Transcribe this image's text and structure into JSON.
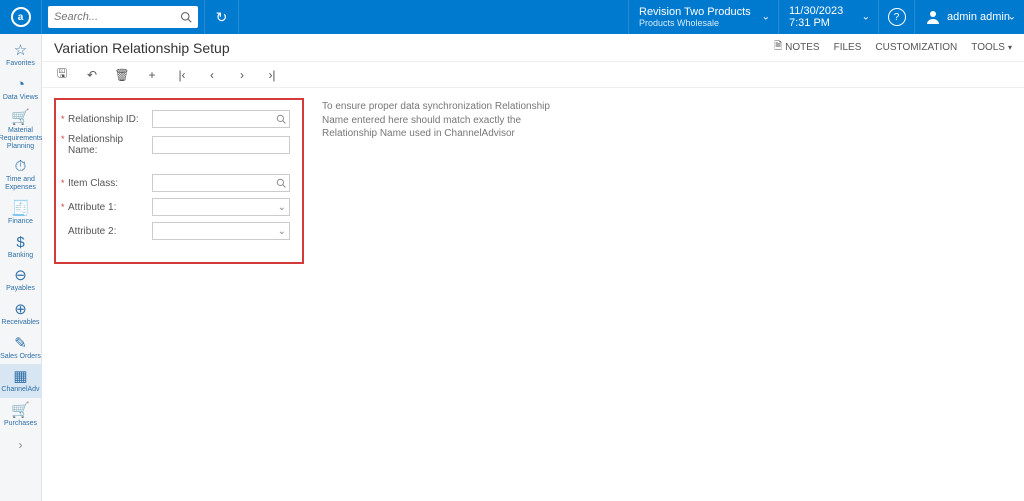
{
  "top": {
    "search_placeholder": "Search...",
    "tenant_line1": "Revision Two Products",
    "tenant_line2": "Products Wholesale",
    "date": "11/30/2023",
    "time": "7:31 PM",
    "user": "admin admin"
  },
  "nav": {
    "items": [
      {
        "label": "Favorites",
        "icon": "☆"
      },
      {
        "label": "Data Views",
        "icon": "◔"
      },
      {
        "label": "Material Requirements Planning",
        "icon": "🛒"
      },
      {
        "label": "Time and Expenses",
        "icon": "⏱"
      },
      {
        "label": "Finance",
        "icon": "🧾"
      },
      {
        "label": "Banking",
        "icon": "$"
      },
      {
        "label": "Payables",
        "icon": "⊖"
      },
      {
        "label": "Receivables",
        "icon": "⊕"
      },
      {
        "label": "Sales Orders",
        "icon": "✎"
      },
      {
        "label": "ChannelAdv",
        "icon": "▦"
      },
      {
        "label": "Purchases",
        "icon": "🛒"
      }
    ],
    "active_index": 9
  },
  "page": {
    "title": "Variation Relationship Setup",
    "actions": {
      "notes": "NOTES",
      "files": "FILES",
      "customization": "CUSTOMIZATION",
      "tools": "TOOLS"
    }
  },
  "form": {
    "relationship_id": {
      "label": "Relationship ID:",
      "value": ""
    },
    "relationship_name": {
      "label": "Relationship Name:",
      "value": ""
    },
    "item_class": {
      "label": "Item Class:",
      "value": ""
    },
    "attribute1": {
      "label": "Attribute 1:",
      "value": ""
    },
    "attribute2": {
      "label": "Attribute 2:",
      "value": ""
    },
    "info": "To ensure proper data synchronization Relationship Name entered here should match exactly the Relationship Name used in ChannelAdvisor"
  }
}
